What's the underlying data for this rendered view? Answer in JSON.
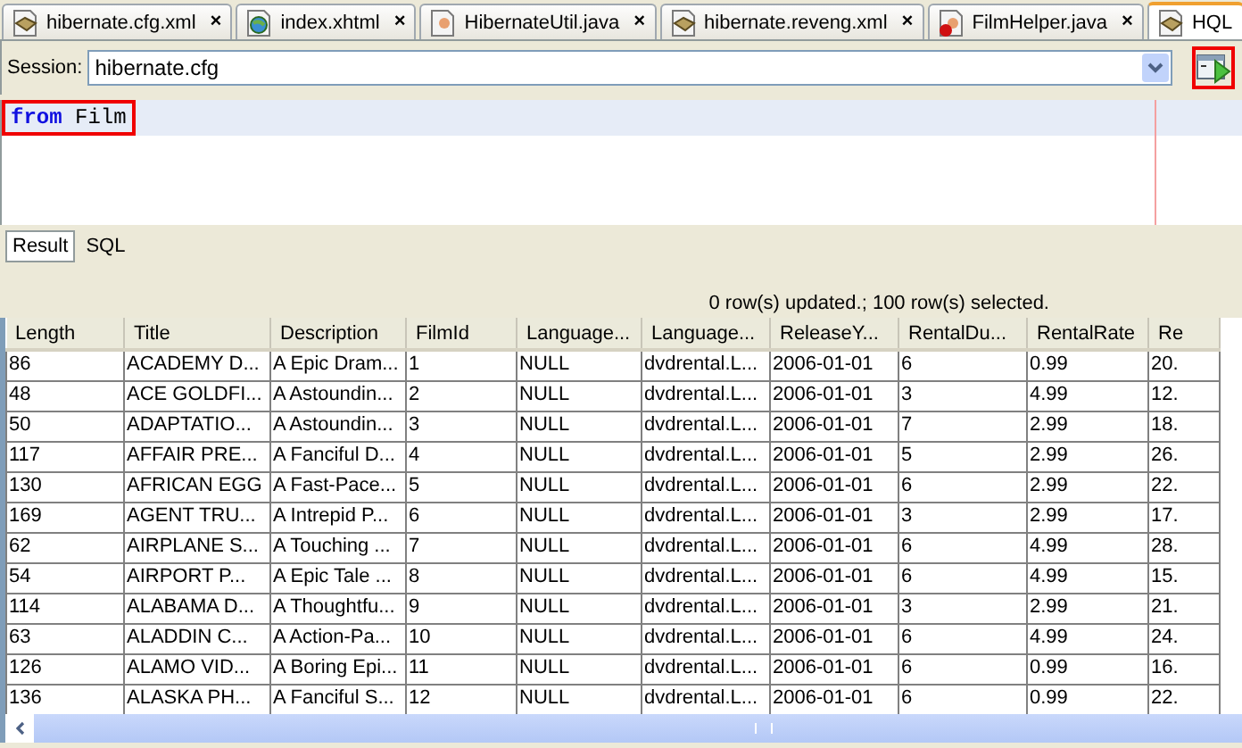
{
  "tabs": [
    {
      "label": "hibernate.cfg.xml",
      "kind": "config",
      "selected": false,
      "close": "×"
    },
    {
      "label": "index.xhtml",
      "kind": "web",
      "selected": false,
      "close": "×"
    },
    {
      "label": "HibernateUtil.java",
      "kind": "java",
      "selected": false,
      "close": "×"
    },
    {
      "label": "hibernate.reveng.xml",
      "kind": "config",
      "selected": false,
      "close": "×"
    },
    {
      "label": "FilmHelper.java",
      "kind": "javaerror",
      "selected": false,
      "close": "×"
    },
    {
      "label": "HQL",
      "kind": "config",
      "selected": true
    }
  ],
  "session": {
    "label": "Session:",
    "value": "hibernate.cfg"
  },
  "run_button": {
    "highlighted": true
  },
  "editor": {
    "query": "**from** Film",
    "highlighted": true
  },
  "result_tabs": [
    {
      "label": "Result",
      "selected": true
    },
    {
      "label": "SQL",
      "selected": false
    }
  ],
  "status": "0 row(s) updated.; 100 row(s) selected.",
  "table": {
    "columns": [
      "Length",
      "Title",
      "Description",
      "FilmId",
      "Language...",
      "Language...",
      "ReleaseY...",
      "RentalDu...",
      "RentalRate",
      "Re"
    ],
    "rows": [
      [
        "86",
        "ACADEMY D...",
        "A Epic Dram...",
        "1",
        "NULL",
        "dvdrental.L...",
        "2006-01-01",
        "6",
        "0.99",
        "20."
      ],
      [
        "48",
        "ACE GOLDFI...",
        "A Astoundin...",
        "2",
        "NULL",
        "dvdrental.L...",
        "2006-01-01",
        "3",
        "4.99",
        "12."
      ],
      [
        "50",
        "ADAPTATIO...",
        "A Astoundin...",
        "3",
        "NULL",
        "dvdrental.L...",
        "2006-01-01",
        "7",
        "2.99",
        "18."
      ],
      [
        "117",
        "AFFAIR PRE...",
        "A Fanciful D...",
        "4",
        "NULL",
        "dvdrental.L...",
        "2006-01-01",
        "5",
        "2.99",
        "26."
      ],
      [
        "130",
        "AFRICAN EGG",
        "A Fast-Pace...",
        "5",
        "NULL",
        "dvdrental.L...",
        "2006-01-01",
        "6",
        "2.99",
        "22."
      ],
      [
        "169",
        "AGENT TRU...",
        "A Intrepid P...",
        "6",
        "NULL",
        "dvdrental.L...",
        "2006-01-01",
        "3",
        "2.99",
        "17."
      ],
      [
        "62",
        "AIRPLANE S...",
        "A Touching ...",
        "7",
        "NULL",
        "dvdrental.L...",
        "2006-01-01",
        "6",
        "4.99",
        "28."
      ],
      [
        "54",
        "AIRPORT P...",
        "A Epic Tale ...",
        "8",
        "NULL",
        "dvdrental.L...",
        "2006-01-01",
        "6",
        "4.99",
        "15."
      ],
      [
        "114",
        "ALABAMA D...",
        "A Thoughtfu...",
        "9",
        "NULL",
        "dvdrental.L...",
        "2006-01-01",
        "3",
        "2.99",
        "21."
      ],
      [
        "63",
        "ALADDIN C...",
        "A Action-Pa...",
        "10",
        "NULL",
        "dvdrental.L...",
        "2006-01-01",
        "6",
        "4.99",
        "24."
      ],
      [
        "126",
        "ALAMO VID...",
        "A Boring Epi...",
        "11",
        "NULL",
        "dvdrental.L...",
        "2006-01-01",
        "6",
        "0.99",
        "16."
      ],
      [
        "136",
        "ALASKA PH...",
        "A Fanciful S...",
        "12",
        "NULL",
        "dvdrental.L...",
        "2006-01-01",
        "6",
        "0.99",
        "22."
      ]
    ]
  }
}
